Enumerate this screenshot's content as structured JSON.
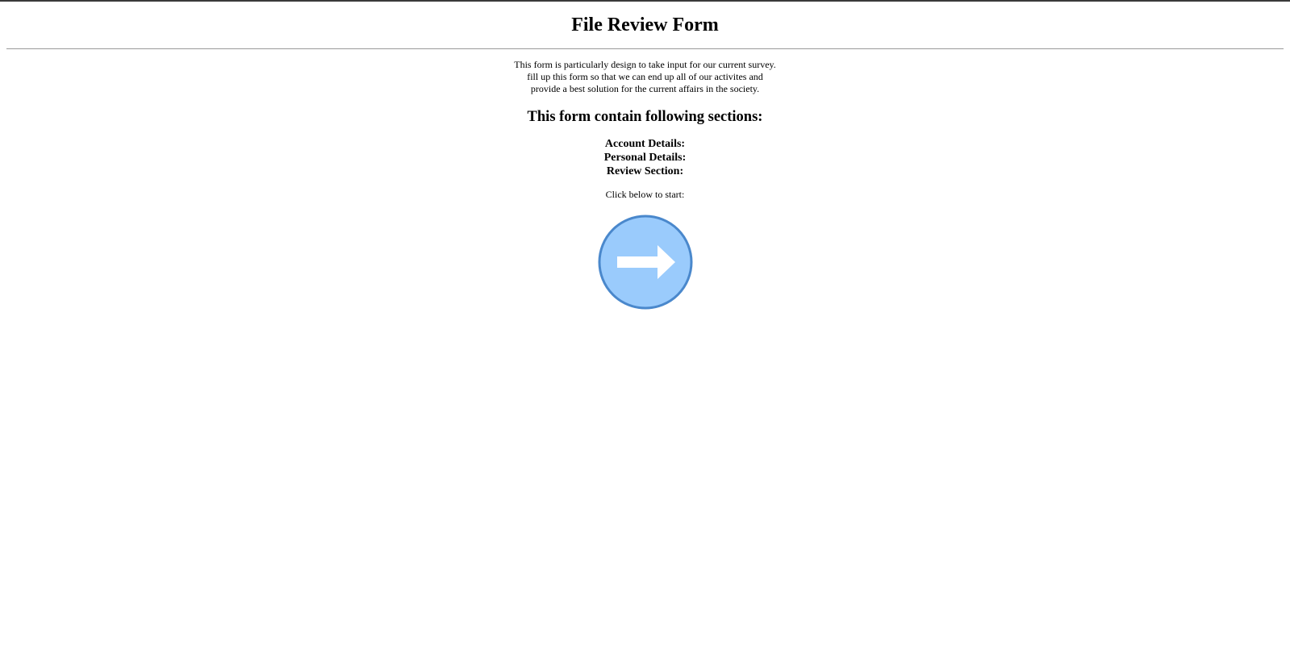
{
  "page": {
    "title": "File Review Form"
  },
  "intro": {
    "lines": [
      "This form is particularly design to take input for our current survey.",
      "fill up this form so that we can end up all of our activites and",
      "provide a best solution for the current affairs in the society."
    ]
  },
  "sections": {
    "heading": "This form contain following sections:",
    "items": [
      "Account Details:",
      "Personal Details:",
      "Review Section:"
    ]
  },
  "start": {
    "hint": "Click below to start:",
    "button_icon": "arrow-right-circle-icon",
    "fill_color": "#9acbfc",
    "border_color": "#4a88cc",
    "arrow_color": "#ffffff"
  }
}
